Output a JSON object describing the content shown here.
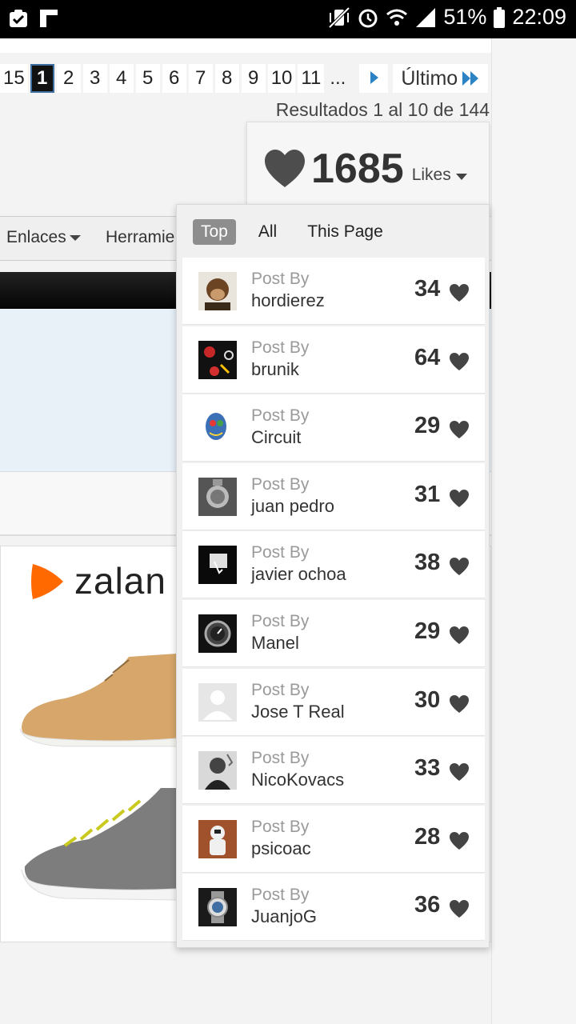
{
  "status_bar": {
    "battery": "51%",
    "time": "22:09"
  },
  "pagination": {
    "pages": [
      "15",
      "1",
      "2",
      "3",
      "4",
      "5",
      "6",
      "7",
      "8",
      "9",
      "10",
      "11",
      "..."
    ],
    "current": "1",
    "last_label": "Último"
  },
  "results_text": "Resultados 1 al 10 de 144",
  "likes": {
    "count": "1685",
    "label": "Likes"
  },
  "nav": {
    "enlaces": "Enlaces",
    "herramientas": "Herramie"
  },
  "ad": {
    "brand": "zalan"
  },
  "dropdown": {
    "tabs": [
      "Top",
      "All",
      "This Page"
    ],
    "active_tab": "Top",
    "post_by_label": "Post By",
    "posts": [
      {
        "author": "hordierez",
        "likes": "34"
      },
      {
        "author": "brunik",
        "likes": "64"
      },
      {
        "author": "Circuit",
        "likes": "29"
      },
      {
        "author": "juan pedro",
        "likes": "31"
      },
      {
        "author": "javier ochoa",
        "likes": "38"
      },
      {
        "author": "Manel",
        "likes": "29"
      },
      {
        "author": "Jose T Real",
        "likes": "30"
      },
      {
        "author": "NicoKovacs",
        "likes": "33"
      },
      {
        "author": "psicoac",
        "likes": "28"
      },
      {
        "author": "JuanjoG",
        "likes": "36"
      }
    ]
  },
  "colors": {
    "accent_blue": "#2b83c4",
    "heart_gray": "#444444",
    "brand_orange": "#ff6900"
  }
}
